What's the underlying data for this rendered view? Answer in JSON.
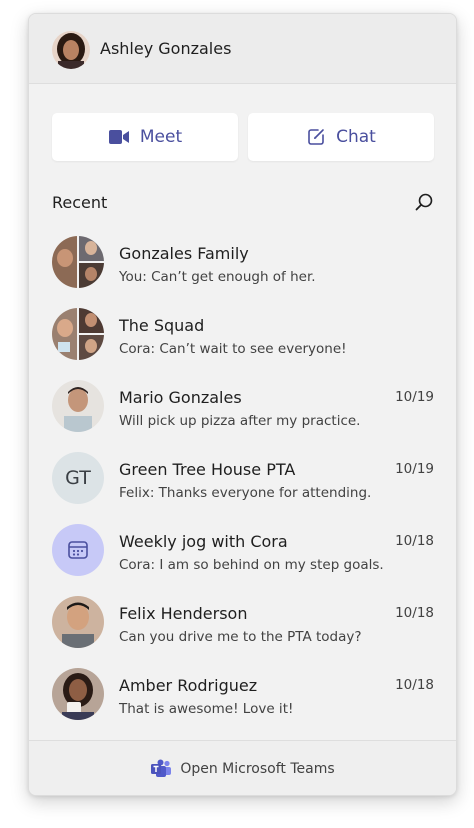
{
  "header": {
    "user_name": "Ashley Gonzales"
  },
  "actions": {
    "meet_label": "Meet",
    "chat_label": "Chat"
  },
  "recent": {
    "label": "Recent"
  },
  "chats": [
    {
      "name": "Gonzales Family",
      "message": "You: Can’t get enough of her.",
      "date": ""
    },
    {
      "name": "The Squad",
      "message": "Cora: Can’t wait to see everyone!",
      "date": ""
    },
    {
      "name": "Mario Gonzales",
      "message": "Will pick up pizza after my practice.",
      "date": "10/19"
    },
    {
      "name": "Green Tree House PTA",
      "message": "Felix: Thanks everyone for attending.",
      "date": "10/19",
      "initials": "GT"
    },
    {
      "name": "Weekly jog with Cora",
      "message": "Cora: I am so behind on my step goals.",
      "date": "10/18"
    },
    {
      "name": "Felix Henderson",
      "message": "Can you drive me to the PTA today?",
      "date": "10/18"
    },
    {
      "name": "Amber Rodriguez",
      "message": "That is awesome! Love it!",
      "date": "10/18"
    }
  ],
  "footer": {
    "label": "Open Microsoft Teams"
  },
  "colors": {
    "accent": "#4a4f9e",
    "panel_bg": "#f2f2f2",
    "calendar_avatar_bg": "#c7c9f7"
  }
}
